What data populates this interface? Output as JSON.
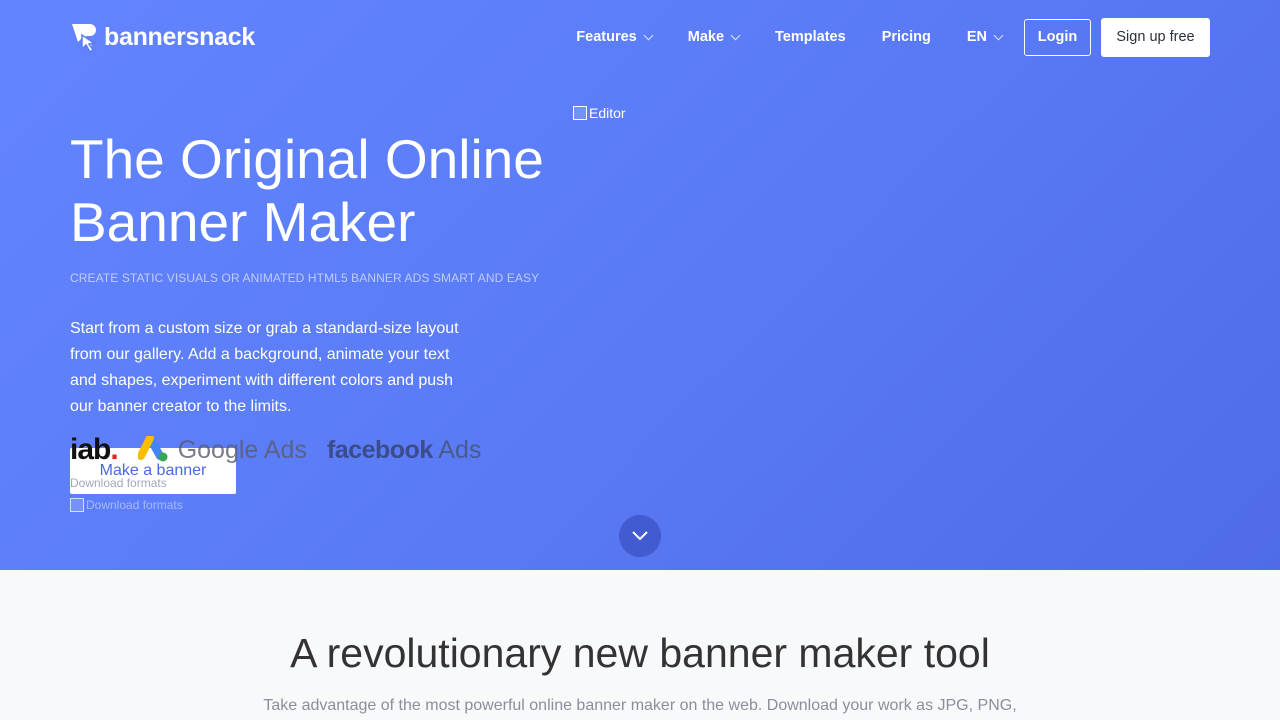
{
  "brand": {
    "name": "bannersnack"
  },
  "nav": {
    "features": "Features",
    "make": "Make",
    "templates": "Templates",
    "pricing": "Pricing",
    "language": "EN",
    "login": "Login",
    "signup": "Sign up free"
  },
  "hero": {
    "title_line1": "The Original Online",
    "title_line2": "Banner Maker",
    "subtitle": "CREATE STATIC VISUALS OR ANIMATED HTML5 BANNER ADS SMART AND EASY",
    "description": "Start from a custom size or grab a standard-size layout from our gallery. Add a background, animate your text and shapes, experiment with different colors and push our banner creator to the limits.",
    "cta": "Make a banner",
    "download_formats_text": "Download formats",
    "download_formats_alt": "Download formats",
    "editor_alt": "Editor"
  },
  "partners": {
    "iab": "iab",
    "iab_dot": ".",
    "google": "Google Ads",
    "facebook_bold": "facebook",
    "facebook_suffix": " Ads"
  },
  "section2": {
    "title": "A revolutionary new banner maker tool",
    "description": "Take advantage of the most powerful online banner maker on the web. Download your work as JPG, PNG,"
  },
  "colors": {
    "hero_gradient_start": "#6384ff",
    "hero_gradient_end": "#4f6be9",
    "cta_text": "#4a67e6",
    "iab_dot": "#e1251b"
  }
}
